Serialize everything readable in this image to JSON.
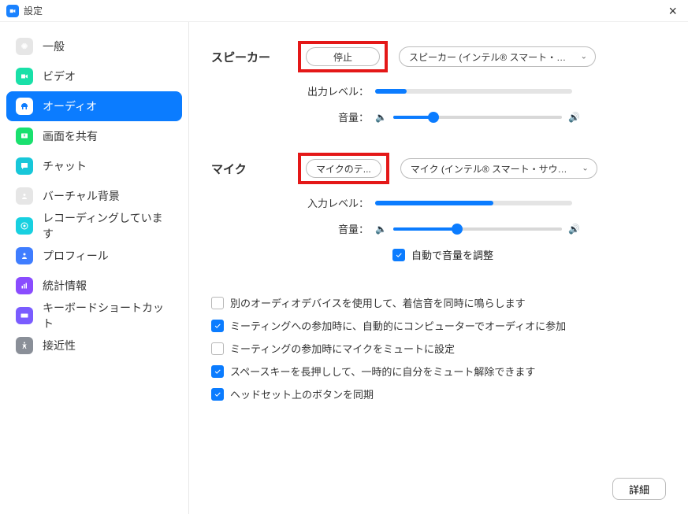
{
  "title": "設定",
  "sidebar": {
    "items": [
      {
        "label": "一般"
      },
      {
        "label": "ビデオ"
      },
      {
        "label": "オーディオ"
      },
      {
        "label": "画面を共有"
      },
      {
        "label": "チャット"
      },
      {
        "label": "バーチャル背景"
      },
      {
        "label": "レコーディングしています"
      },
      {
        "label": "プロフィール"
      },
      {
        "label": "統計情報"
      },
      {
        "label": "キーボードショートカット"
      },
      {
        "label": "接近性"
      }
    ]
  },
  "speaker": {
    "label": "スピーカー",
    "test_btn": "停止",
    "dropdown": "スピーカー (インテル® スマート・…",
    "output_level_label": "出力レベル：",
    "output_level_pct": 16,
    "volume_label": "音量：",
    "volume_pct": 24
  },
  "mic": {
    "label": "マイク",
    "test_btn": "マイクのテ...",
    "dropdown": "マイク (インテル® スマート・サウ…",
    "input_level_label": "入力レベル：",
    "input_level_pct": 60,
    "volume_label": "音量：",
    "volume_pct": 38,
    "auto_adjust": "自動で音量を調整"
  },
  "options": {
    "ring_separate": "別のオーディオデバイスを使用して、着信音を同時に鳴らします",
    "auto_join": "ミーティングへの参加時に、自動的にコンピューターでオーディオに参加",
    "mute_on_join": "ミーティングの参加時にマイクをミュートに設定",
    "space_unmute": "スペースキーを長押しして、一時的に自分をミュート解除できます",
    "sync_headset": "ヘッドセット上のボタンを同期"
  },
  "advanced_btn": "詳細"
}
